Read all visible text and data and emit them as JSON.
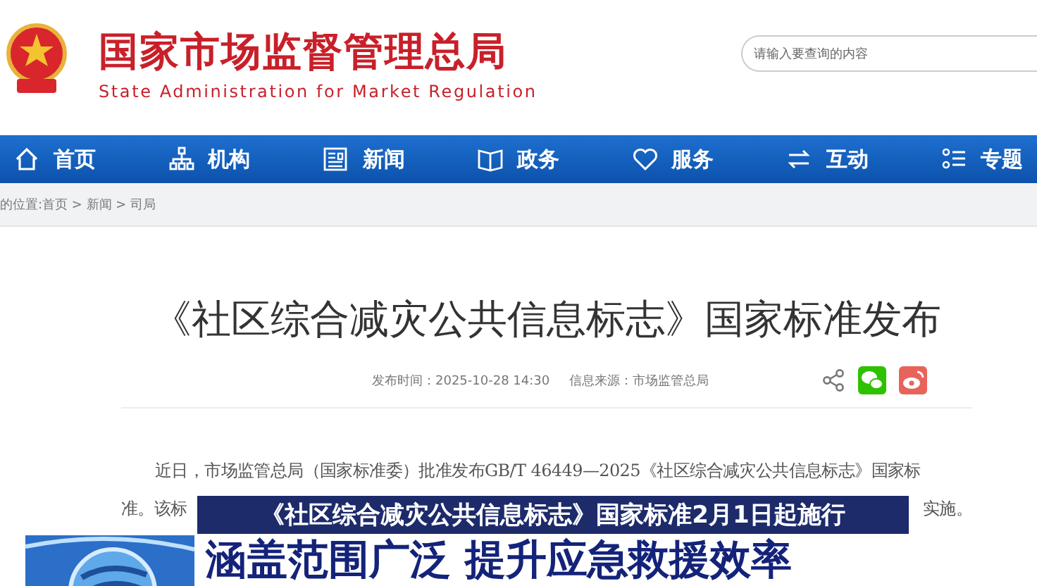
{
  "header": {
    "site_name": "国家市场监督管理总局",
    "site_name_en": "State Administration for Market Regulation",
    "search": {
      "placeholder": "请输入要查询的内容"
    }
  },
  "nav": [
    {
      "label": "首页"
    },
    {
      "label": "机构"
    },
    {
      "label": "新闻"
    },
    {
      "label": "政务"
    },
    {
      "label": "服务"
    },
    {
      "label": "互动"
    },
    {
      "label": "专题"
    }
  ],
  "breadcrumb": "的位置:首页 > 新闻 > 司局",
  "article": {
    "title": "《社区综合减灾公共信息标志》国家标准发布",
    "published": "发布时间：2025-10-28 14:30",
    "source": "信息来源：市场监管总局",
    "body_line_1": "近日，市场监管总局（国家标准委）批准发布GB/T 46449—2025《社区综合减灾公共信息标志》国家标",
    "body_line_2_start": "准。该标",
    "body_line_2_end": "实施。"
  },
  "caption": {
    "subtitle": "《社区综合减灾公共信息标志》国家标准2月1日起施行",
    "headline": "涵盖范围广泛 提升应急救援效率"
  }
}
